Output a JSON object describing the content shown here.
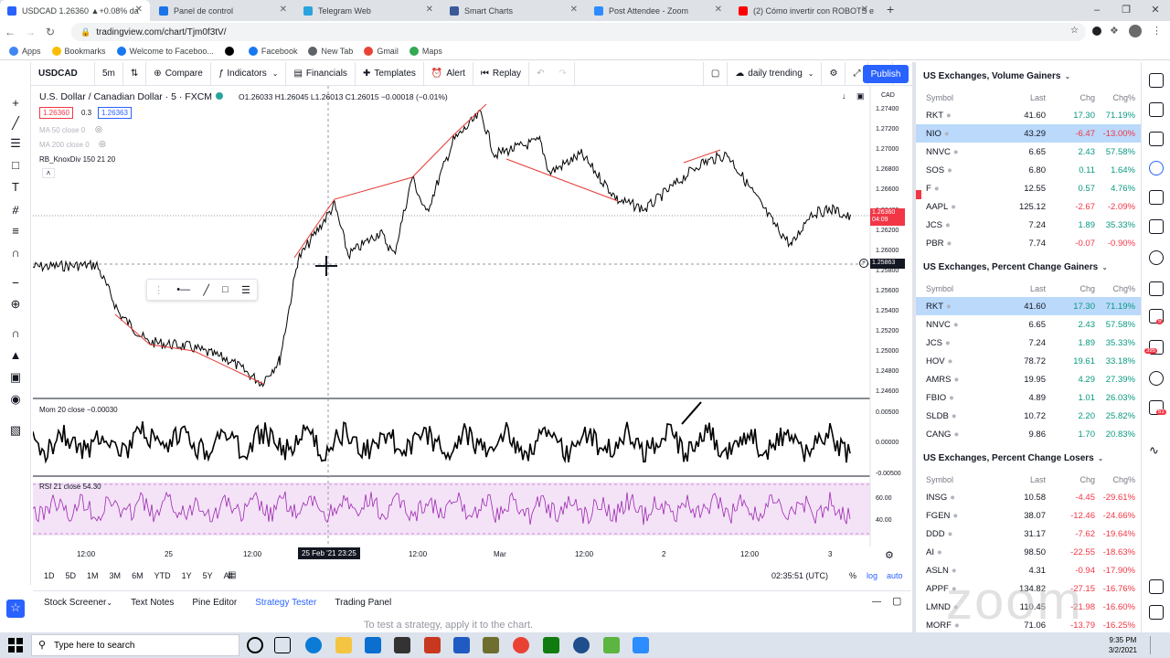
{
  "browser": {
    "tabs": [
      {
        "title": "USDCAD 1.26360 ▲+0.08% da",
        "color": "#2962ff",
        "active": true
      },
      {
        "title": "Panel de control",
        "color": "#1a73e8"
      },
      {
        "title": "Telegram Web",
        "color": "#2aa3df"
      },
      {
        "title": "Smart Charts",
        "color": "#3b5998"
      },
      {
        "title": "Post Attendee - Zoom",
        "color": "#2d8cff"
      },
      {
        "title": "(2) Cómo invertir con ROBOTS e",
        "color": "#ff0000"
      }
    ],
    "new_tab": "+",
    "url": "tradingview.com/chart/Tjm0f3tV/",
    "bookmarks": [
      {
        "label": "Apps",
        "color": "#4285f4"
      },
      {
        "label": "Bookmarks",
        "color": "#fbbc04"
      },
      {
        "label": "Welcome to Faceboo...",
        "color": "#1877f2"
      },
      {
        "label": "",
        "color": "#000"
      },
      {
        "label": "Facebook",
        "color": "#1877f2"
      },
      {
        "label": "New Tab",
        "color": "#5f6368"
      },
      {
        "label": "Gmail",
        "color": "#ea4335"
      },
      {
        "label": "Maps",
        "color": "#34a853"
      }
    ]
  },
  "toolbar": {
    "symbol": "USDCAD",
    "interval": "5m",
    "compare": "Compare",
    "indicators": "Indicators",
    "financials": "Financials",
    "templates": "Templates",
    "alert": "Alert",
    "replay": "Replay",
    "layout": "daily trending",
    "publish": "Publish",
    "notif": "11"
  },
  "legend": {
    "title": "U.S. Dollar / Canadian Dollar · 5 · FXCM",
    "ohlc": "O1.26033  H1.26045  L1.26013  C1.26015  −0.00018 (−0.01%)",
    "bid": "1.26360",
    "spread": "0.3",
    "ask": "1.26363",
    "ma50": "MA 50 close 0",
    "ma200": "MA 200 close 0",
    "knox": "RB_KnoxDiv 150 21 20",
    "mom": "Mom 20 close  −0.00030",
    "rsi": "RSI 21 close  54.30"
  },
  "price_axis": {
    "unit": "CAD",
    "ticks": [
      "1.27400",
      "1.27200",
      "1.27000",
      "1.26800",
      "1.26600",
      "1.26400",
      "1.26200",
      "1.26000",
      "1.25800",
      "1.25600",
      "1.25400",
      "1.25200",
      "1.25000",
      "1.24800",
      "1.24600"
    ],
    "last_price": "1.26360",
    "last_time": "04:09",
    "cursor_price": "1.25863",
    "mom_ticks": [
      "0.00500",
      "0.00000",
      "-0.00500"
    ],
    "rsi_ticks": [
      "60.00",
      "40.00"
    ]
  },
  "time_axis": {
    "labels": [
      "12:00",
      "25",
      "12:00",
      "12:00",
      "Mar",
      "12:00",
      "2",
      "12:00",
      "3"
    ],
    "cursor": "25 Feb '21  23:25"
  },
  "ranges": [
    "1D",
    "5D",
    "1M",
    "3M",
    "6M",
    "YTD",
    "1Y",
    "5Y",
    "All"
  ],
  "status": {
    "time": "02:35:51 (UTC)",
    "pct": "%",
    "log": "log",
    "auto": "auto"
  },
  "bottom_tabs": [
    "Stock Screener",
    "Text Notes",
    "Pine Editor",
    "Strategy Tester",
    "Trading Panel"
  ],
  "strategy_msg": "To test a strategy, apply it to the chart.",
  "watchlist": {
    "header": {
      "symbol": "Symbol",
      "last": "Last",
      "chg": "Chg",
      "chgp": "Chg%"
    },
    "sections": [
      {
        "title": "US Exchanges, Volume Gainers",
        "rows": [
          {
            "s": "RKT",
            "l": "41.60",
            "c": "17.30",
            "p": "71.19%",
            "up": true
          },
          {
            "s": "NIO",
            "l": "43.29",
            "c": "-6.47",
            "p": "-13.00%",
            "up": false,
            "sel": true
          },
          {
            "s": "NNVC",
            "l": "6.65",
            "c": "2.43",
            "p": "57.58%",
            "up": true
          },
          {
            "s": "SOS",
            "l": "6.80",
            "c": "0.11",
            "p": "1.64%",
            "up": true
          },
          {
            "s": "F",
            "l": "12.55",
            "c": "0.57",
            "p": "4.76%",
            "up": true
          },
          {
            "s": "AAPL",
            "l": "125.12",
            "c": "-2.67",
            "p": "-2.09%",
            "up": false
          },
          {
            "s": "JCS",
            "l": "7.24",
            "c": "1.89",
            "p": "35.33%",
            "up": true
          },
          {
            "s": "PBR",
            "l": "7.74",
            "c": "-0.07",
            "p": "-0.90%",
            "up": false
          }
        ]
      },
      {
        "title": "US Exchanges, Percent Change Gainers",
        "rows": [
          {
            "s": "RKT",
            "l": "41.60",
            "c": "17.30",
            "p": "71.19%",
            "up": true,
            "sel": true
          },
          {
            "s": "NNVC",
            "l": "6.65",
            "c": "2.43",
            "p": "57.58%",
            "up": true
          },
          {
            "s": "JCS",
            "l": "7.24",
            "c": "1.89",
            "p": "35.33%",
            "up": true
          },
          {
            "s": "HOV",
            "l": "78.72",
            "c": "19.61",
            "p": "33.18%",
            "up": true
          },
          {
            "s": "AMRS",
            "l": "19.95",
            "c": "4.29",
            "p": "27.39%",
            "up": true
          },
          {
            "s": "FBIO",
            "l": "4.89",
            "c": "1.01",
            "p": "26.03%",
            "up": true
          },
          {
            "s": "SLDB",
            "l": "10.72",
            "c": "2.20",
            "p": "25.82%",
            "up": true
          },
          {
            "s": "CANG",
            "l": "9.86",
            "c": "1.70",
            "p": "20.83%",
            "up": true
          }
        ]
      },
      {
        "title": "US Exchanges, Percent Change Losers",
        "rows": [
          {
            "s": "INSG",
            "l": "10.58",
            "c": "-4.45",
            "p": "-29.61%",
            "up": false
          },
          {
            "s": "FGEN",
            "l": "38.07",
            "c": "-12.46",
            "p": "-24.66%",
            "up": false
          },
          {
            "s": "DDD",
            "l": "31.17",
            "c": "-7.62",
            "p": "-19.64%",
            "up": false
          },
          {
            "s": "AI",
            "l": "98.50",
            "c": "-22.55",
            "p": "-18.63%",
            "up": false
          },
          {
            "s": "ASLN",
            "l": "4.31",
            "c": "-0.94",
            "p": "-17.90%",
            "up": false
          },
          {
            "s": "APPF",
            "l": "134.82",
            "c": "-27.15",
            "p": "-16.76%",
            "up": false
          },
          {
            "s": "LMND",
            "l": "110.45",
            "c": "-21.98",
            "p": "-16.60%",
            "up": false
          },
          {
            "s": "MORF",
            "l": "71.06",
            "c": "-13.79",
            "p": "-16.25%",
            "up": false
          }
        ]
      }
    ]
  },
  "taskbar": {
    "search": "Type here to search",
    "time": "9:35 PM",
    "date": "3/2/2021"
  },
  "badges": {
    "a": "5",
    "b": "395",
    "c": "61"
  }
}
